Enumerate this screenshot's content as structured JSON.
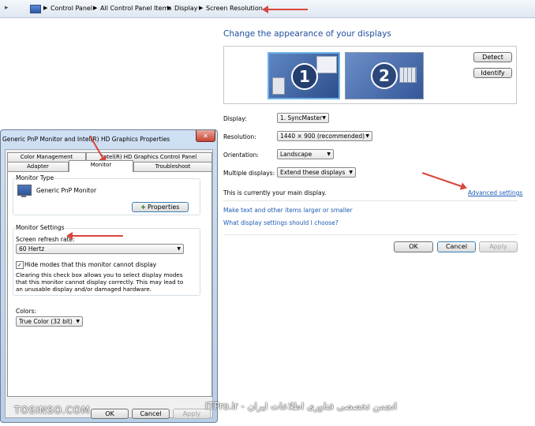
{
  "breadcrumb": {
    "items": [
      "Control Panel",
      "All Control Panel Items",
      "Display",
      "Screen Resolution"
    ]
  },
  "main": {
    "heading": "Change the appearance of your displays",
    "monitors": [
      "1",
      "2"
    ],
    "detect_label": "Detect",
    "identify_label": "Identify",
    "display_label": "Display:",
    "display_value": "1. SyncMaster",
    "resolution_label": "Resolution:",
    "resolution_value": "1440 × 900 (recommended)",
    "orientation_label": "Orientation:",
    "orientation_value": "Landscape",
    "multiple_label": "Multiple displays:",
    "multiple_value": "Extend these displays",
    "main_display_text": "This is currently your main display.",
    "advanced_link": "Advanced settings",
    "link_text_size": "Make text and other items larger or smaller",
    "link_which_settings": "What display settings should I choose?",
    "ok_label": "OK",
    "cancel_label": "Cancel",
    "apply_label": "Apply"
  },
  "dialog": {
    "title": "Generic PnP Monitor and Intel(R) HD Graphics Properties",
    "close_label": "✕",
    "tabs_back": [
      "Color Management",
      "Intel(R) HD Graphics Control Panel"
    ],
    "tabs_front": [
      "Adapter",
      "Monitor",
      "Troubleshoot"
    ],
    "monitor_type_title": "Monitor Type",
    "monitor_name": "Generic PnP Monitor",
    "properties_label": "Properties",
    "monitor_settings_title": "Monitor Settings",
    "refresh_label": "Screen refresh rate:",
    "refresh_value": "60 Hertz",
    "hide_modes_label": "Hide modes that this monitor cannot display",
    "hide_modes_checked": true,
    "hide_modes_desc": "Clearing this check box allows you to select display modes that this monitor cannot display correctly. This may lead to an unusable display and/or damaged hardware.",
    "colors_label": "Colors:",
    "colors_value": "True Color (32 bit)",
    "ok_label": "OK",
    "cancel_label": "Cancel",
    "apply_label": "Apply"
  },
  "watermark": {
    "left": "TOSINSO.COM",
    "right": "انجمن تخصصی فناوری اطلاعات ایران - ITPro.ir"
  },
  "colors": {
    "accent_link": "#1e5cb3",
    "heading": "#1e4d9b",
    "annotation_arrow": "#d9453c"
  }
}
